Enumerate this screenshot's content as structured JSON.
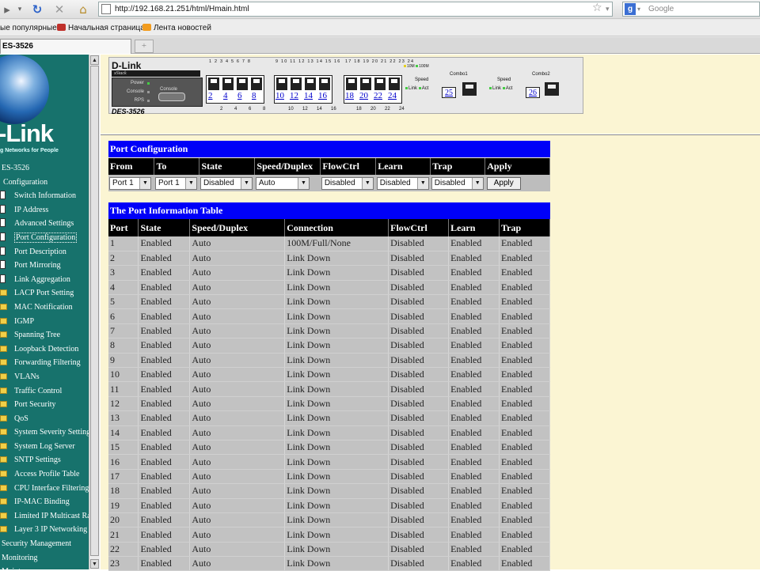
{
  "browser": {
    "url": "http://192.168.21.251/html/Hmain.html",
    "search_placeholder": "Google",
    "tab_title": "ES-3526",
    "bookmarks": [
      "ые популярные",
      "Начальная страница",
      "Лента новостей"
    ]
  },
  "sidebar": {
    "brand": "-Link",
    "tagline": "g Networks for People",
    "items": [
      {
        "label": "ES-3526",
        "level": 1,
        "icon": "none"
      },
      {
        "label": "Configuration",
        "level": 2,
        "icon": "none"
      },
      {
        "label": "Switch Information",
        "level": 3,
        "icon": "page"
      },
      {
        "label": "IP Address",
        "level": 3,
        "icon": "page"
      },
      {
        "label": "Advanced Settings",
        "level": 3,
        "icon": "page"
      },
      {
        "label": "Port Configuration",
        "level": 3,
        "icon": "page",
        "selected": true
      },
      {
        "label": "Port Description",
        "level": 3,
        "icon": "page"
      },
      {
        "label": "Port Mirroring",
        "level": 3,
        "icon": "page"
      },
      {
        "label": "Link Aggregation",
        "level": 3,
        "icon": "page"
      },
      {
        "label": "LACP Port Setting",
        "level": 3,
        "icon": "folder"
      },
      {
        "label": "MAC Notification",
        "level": 3,
        "icon": "folder"
      },
      {
        "label": "IGMP",
        "level": 3,
        "icon": "folder"
      },
      {
        "label": "Spanning Tree",
        "level": 3,
        "icon": "folder"
      },
      {
        "label": "Loopback Detection",
        "level": 3,
        "icon": "folder"
      },
      {
        "label": "Forwarding Filtering",
        "level": 3,
        "icon": "folder"
      },
      {
        "label": "VLANs",
        "level": 3,
        "icon": "folder"
      },
      {
        "label": "Traffic Control",
        "level": 3,
        "icon": "folder"
      },
      {
        "label": "Port Security",
        "level": 3,
        "icon": "folder"
      },
      {
        "label": "QoS",
        "level": 3,
        "icon": "folder"
      },
      {
        "label": "System Severity Setting",
        "level": 3,
        "icon": "folder"
      },
      {
        "label": "System Log Server",
        "level": 3,
        "icon": "folder"
      },
      {
        "label": "SNTP Settings",
        "level": 3,
        "icon": "folder"
      },
      {
        "label": "Access Profile Table",
        "level": 3,
        "icon": "folder"
      },
      {
        "label": "CPU Interface Filtering",
        "level": 3,
        "icon": "folder"
      },
      {
        "label": "IP-MAC Binding",
        "level": 3,
        "icon": "folder"
      },
      {
        "label": "Limited IP Multicast Ra",
        "level": 3,
        "icon": "folder"
      },
      {
        "label": "Layer 3 IP Networking",
        "level": 3,
        "icon": "folder"
      },
      {
        "label": "Security Management",
        "level": 1,
        "icon": "none"
      },
      {
        "label": "Monitoring",
        "level": 1,
        "icon": "none"
      },
      {
        "label": "Maintenance",
        "level": 1,
        "icon": "none"
      }
    ]
  },
  "device": {
    "logo": "D-Link",
    "xstack": "xStack",
    "model": "DES-3526",
    "status_labels": [
      "Power",
      "Console",
      "RPS"
    ],
    "console_label": "Console",
    "top_numbers": [
      "1 2 3 4 5 6 7 8",
      "9 10 11 12 13 14 15 16",
      "17 18 19 20 21 22 23 24"
    ],
    "groups": [
      [
        "2",
        "4",
        "6",
        "8"
      ],
      [
        "10",
        "12",
        "14",
        "16"
      ],
      [
        "18",
        "20",
        "22",
        "24"
      ]
    ],
    "bottom_numbers": [
      "2",
      "4",
      "6",
      "8",
      "10",
      "12",
      "14",
      "16",
      "18",
      "20",
      "22",
      "24"
    ],
    "legend_10m": "10M",
    "legend_100m": "100M",
    "speed_label": "Speed",
    "link_label": "Link",
    "act_label": "Act",
    "combo1_label": "Combo1",
    "combo2_label": "Combo2",
    "combo1_port": "25",
    "combo2_port": "26"
  },
  "port_config": {
    "title": "Port Configuration",
    "headers": [
      "From",
      "To",
      "State",
      "Speed/Duplex",
      "FlowCtrl",
      "Learn",
      "Trap",
      "Apply"
    ],
    "from": "Port 1",
    "to": "Port 1",
    "state": "Disabled",
    "speed": "Auto",
    "flowctrl": "Disabled",
    "learn": "Disabled",
    "trap": "Disabled",
    "apply_label": "Apply"
  },
  "port_info": {
    "title": "The Port Information Table",
    "headers": [
      "Port",
      "State",
      "Speed/Duplex",
      "Connection",
      "FlowCtrl",
      "Learn",
      "Trap"
    ],
    "rows": [
      [
        "1",
        "Enabled",
        "Auto",
        "100M/Full/None",
        "Disabled",
        "Enabled",
        "Enabled"
      ],
      [
        "2",
        "Enabled",
        "Auto",
        "Link Down",
        "Disabled",
        "Enabled",
        "Enabled"
      ],
      [
        "3",
        "Enabled",
        "Auto",
        "Link Down",
        "Disabled",
        "Enabled",
        "Enabled"
      ],
      [
        "4",
        "Enabled",
        "Auto",
        "Link Down",
        "Disabled",
        "Enabled",
        "Enabled"
      ],
      [
        "5",
        "Enabled",
        "Auto",
        "Link Down",
        "Disabled",
        "Enabled",
        "Enabled"
      ],
      [
        "6",
        "Enabled",
        "Auto",
        "Link Down",
        "Disabled",
        "Enabled",
        "Enabled"
      ],
      [
        "7",
        "Enabled",
        "Auto",
        "Link Down",
        "Disabled",
        "Enabled",
        "Enabled"
      ],
      [
        "8",
        "Enabled",
        "Auto",
        "Link Down",
        "Disabled",
        "Enabled",
        "Enabled"
      ],
      [
        "9",
        "Enabled",
        "Auto",
        "Link Down",
        "Disabled",
        "Enabled",
        "Enabled"
      ],
      [
        "10",
        "Enabled",
        "Auto",
        "Link Down",
        "Disabled",
        "Enabled",
        "Enabled"
      ],
      [
        "11",
        "Enabled",
        "Auto",
        "Link Down",
        "Disabled",
        "Enabled",
        "Enabled"
      ],
      [
        "12",
        "Enabled",
        "Auto",
        "Link Down",
        "Disabled",
        "Enabled",
        "Enabled"
      ],
      [
        "13",
        "Enabled",
        "Auto",
        "Link Down",
        "Disabled",
        "Enabled",
        "Enabled"
      ],
      [
        "14",
        "Enabled",
        "Auto",
        "Link Down",
        "Disabled",
        "Enabled",
        "Enabled"
      ],
      [
        "15",
        "Enabled",
        "Auto",
        "Link Down",
        "Disabled",
        "Enabled",
        "Enabled"
      ],
      [
        "16",
        "Enabled",
        "Auto",
        "Link Down",
        "Disabled",
        "Enabled",
        "Enabled"
      ],
      [
        "17",
        "Enabled",
        "Auto",
        "Link Down",
        "Disabled",
        "Enabled",
        "Enabled"
      ],
      [
        "18",
        "Enabled",
        "Auto",
        "Link Down",
        "Disabled",
        "Enabled",
        "Enabled"
      ],
      [
        "19",
        "Enabled",
        "Auto",
        "Link Down",
        "Disabled",
        "Enabled",
        "Enabled"
      ],
      [
        "20",
        "Enabled",
        "Auto",
        "Link Down",
        "Disabled",
        "Enabled",
        "Enabled"
      ],
      [
        "21",
        "Enabled",
        "Auto",
        "Link Down",
        "Disabled",
        "Enabled",
        "Enabled"
      ],
      [
        "22",
        "Enabled",
        "Auto",
        "Link Down",
        "Disabled",
        "Enabled",
        "Enabled"
      ],
      [
        "23",
        "Enabled",
        "Auto",
        "Link Down",
        "Disabled",
        "Enabled",
        "Enabled"
      ]
    ]
  },
  "colors": {
    "sidebar_bg": "#17726c",
    "header_blue": "#0000f8",
    "page_bg": "#fbf5d3"
  }
}
